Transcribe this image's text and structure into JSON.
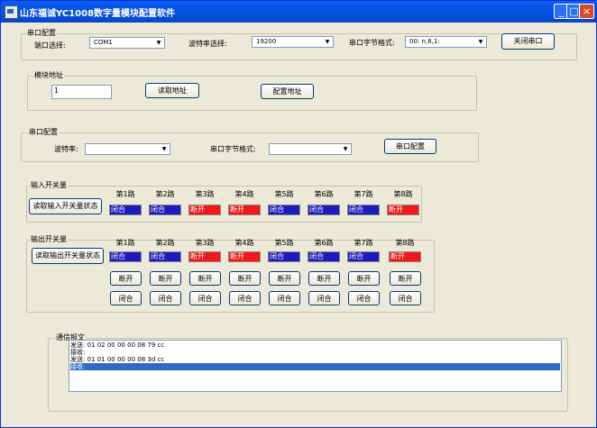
{
  "window": {
    "title": "山东福诚YC1008数字量模块配置软件",
    "buttons": {
      "minimize": "_",
      "maximize": "□",
      "close": "×"
    }
  },
  "serial_config": {
    "title": "串口配置",
    "port_label": "端口选择:",
    "port_value": "COM1",
    "baud_label": "波特率选择:",
    "baud_value": "19200",
    "format_label": "串口字节格式:",
    "format_value": "00: n,8,1:",
    "close_button": "关闭串口"
  },
  "module_address": {
    "title": "模块地址",
    "address_value": "1",
    "read_button": "读取地址",
    "config_button": "配置地址"
  },
  "port_config": {
    "title": "串口配置",
    "baud_label": "波特率:",
    "baud_value": "",
    "format_label": "串口字节格式:",
    "format_value": "",
    "config_button": "串口配置"
  },
  "inputs": {
    "title": "输入开关量",
    "read_button": "读取输入开关量状态",
    "channels": [
      {
        "label": "第1路",
        "state": "闭合",
        "color": "#1c1cbd"
      },
      {
        "label": "第2路",
        "state": "闭合",
        "color": "#1c1cbd"
      },
      {
        "label": "第3路",
        "state": "断开",
        "color": "#f01818"
      },
      {
        "label": "第4路",
        "state": "断开",
        "color": "#f01818"
      },
      {
        "label": "第5路",
        "state": "闭合",
        "color": "#1c1cbd"
      },
      {
        "label": "第6路",
        "state": "闭合",
        "color": "#1c1cbd"
      },
      {
        "label": "第7路",
        "state": "闭合",
        "color": "#1c1cbd"
      },
      {
        "label": "第8路",
        "state": "断开",
        "color": "#f01818"
      }
    ]
  },
  "outputs": {
    "title": "输出开关量",
    "read_button": "读取输出开关量状态",
    "open_label": "断开",
    "close_label": "闭合",
    "channels": [
      {
        "label": "第1路",
        "state": "闭合",
        "color": "#1c1cbd"
      },
      {
        "label": "第2路",
        "state": "闭合",
        "color": "#1c1cbd"
      },
      {
        "label": "第3路",
        "state": "断开",
        "color": "#f01818"
      },
      {
        "label": "第4路",
        "state": "断开",
        "color": "#f01818"
      },
      {
        "label": "第5路",
        "state": "闭合",
        "color": "#1c1cbd"
      },
      {
        "label": "第6路",
        "state": "闭合",
        "color": "#1c1cbd"
      },
      {
        "label": "第7路",
        "state": "闭合",
        "color": "#1c1cbd"
      },
      {
        "label": "第8路",
        "state": "断开",
        "color": "#f01818"
      }
    ]
  },
  "comm_log": {
    "title": "通信报文",
    "lines": [
      {
        "text": "发送:  01  02  00  00  00  08  79  cc",
        "selected": false
      },
      {
        "text": "接收:",
        "selected": false
      },
      {
        "text": "发送:  01  01  00  00  00  08  3d  cc",
        "selected": false
      },
      {
        "text": "接收:",
        "selected": true
      }
    ]
  }
}
